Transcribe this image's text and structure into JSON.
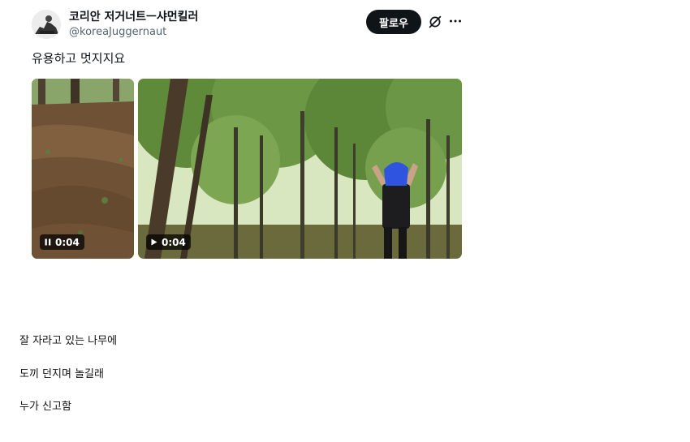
{
  "tweet": {
    "display_name": "코리안 저거너트ㅡ샤먼킬러",
    "handle": "@koreaJuggernaut",
    "follow_label": "팔로우",
    "text": "유용하고 멋지지요",
    "media": [
      {
        "type": "video",
        "duration": "0:04",
        "state": "playing",
        "control_icon": "pause-icon"
      },
      {
        "type": "video",
        "duration": "0:04",
        "state": "paused",
        "control_icon": "play-icon"
      }
    ]
  },
  "caption": {
    "lines": [
      "잘 자라고 있는 나무에",
      "도끼 던지며 놀길래",
      "누가 신고함"
    ]
  },
  "colors": {
    "text_primary": "#0f1419",
    "text_secondary": "#536471",
    "button_bg": "#0f1419",
    "button_text": "#ffffff"
  }
}
